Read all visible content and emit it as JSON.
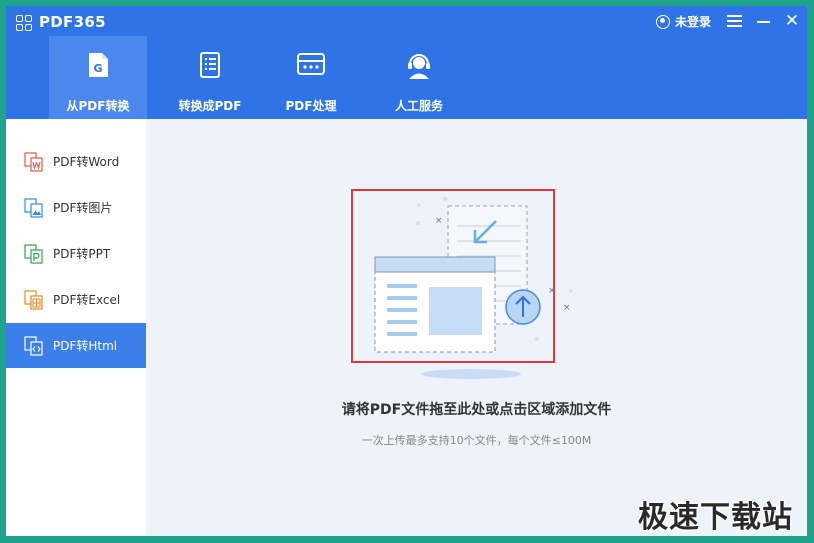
{
  "app": {
    "title": "PDF365",
    "login_label": "未登录"
  },
  "tabs": [
    {
      "label": "从PDF转换"
    },
    {
      "label": "转换成PDF"
    },
    {
      "label": "PDF处理"
    },
    {
      "label": "人工服务"
    }
  ],
  "sidebar": {
    "items": [
      {
        "label": "PDF转Word",
        "color": "#e2554b"
      },
      {
        "label": "PDF转图片",
        "color": "#2f8fd8"
      },
      {
        "label": "PDF转PPT",
        "color": "#2ea44f"
      },
      {
        "label": "PDF转Excel",
        "color": "#e58a1f"
      },
      {
        "label": "PDF转Html",
        "color": "#2f74e6"
      }
    ]
  },
  "dropzone": {
    "title": "请将PDF文件拖至此处或点击区域添加文件",
    "subtitle": "一次上传最多支持10个文件，每个文件≤100M"
  },
  "watermark": "极速下载站",
  "colors": {
    "topbar": "#2f74e6",
    "active_tab": "#4a88ee",
    "sidebar_active": "#3b7fea",
    "highlight_border": "#e0383e"
  }
}
